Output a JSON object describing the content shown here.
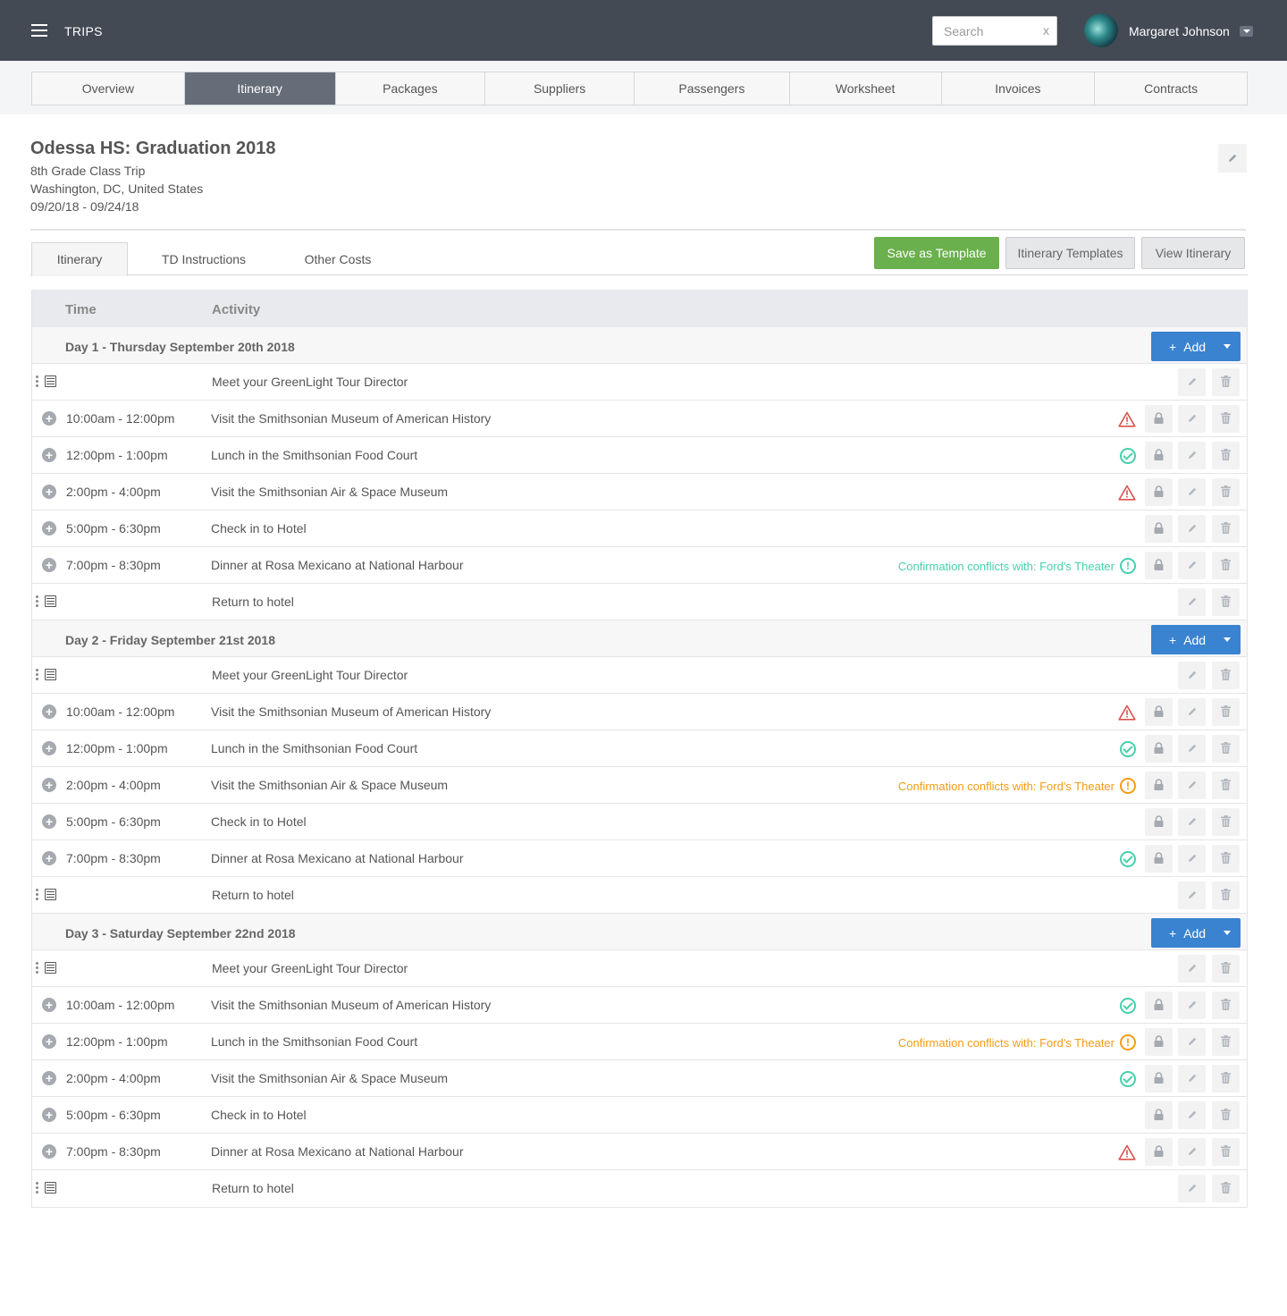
{
  "app": {
    "title": "TRIPS"
  },
  "search": {
    "placeholder": "Search",
    "clear": "x"
  },
  "user": {
    "name": "Margaret Johnson"
  },
  "main_tabs": [
    "Overview",
    "Itinerary",
    "Packages",
    "Suppliers",
    "Passengers",
    "Worksheet",
    "Invoices",
    "Contracts"
  ],
  "main_tab_active": "Itinerary",
  "trip": {
    "title": "Odessa HS: Graduation 2018",
    "subtitle": "8th Grade Class Trip",
    "location": "Washington, DC, United States",
    "dates": "09/20/18 - 09/24/18"
  },
  "sub_tabs": [
    "Itinerary",
    "TD Instructions",
    "Other Costs"
  ],
  "actions": {
    "save_template": "Save as Template",
    "itinerary_templates": "Itinerary Templates",
    "view_itinerary": "View Itinerary"
  },
  "table": {
    "col_time": "Time",
    "col_activity": "Activity",
    "add_label": "Add",
    "add_plus": "+"
  },
  "colors": {
    "topbar": "#434a54",
    "primary": "#3a83d0",
    "success": "#6ab04c",
    "teal": "#48cfad",
    "orange": "#f39c12",
    "danger": "#d9534f"
  },
  "days": [
    {
      "title": "Day 1 - Thursday September 20th 2018",
      "items": [
        {
          "kind": "note",
          "time": "",
          "activity": "Meet your GreenLight Tour Director",
          "status": "none",
          "status_text": "",
          "lock": false
        },
        {
          "kind": "event",
          "time": "10:00am - 12:00pm",
          "activity": "Visit the Smithsonian Museum of American History",
          "status": "warning-icon",
          "status_text": "",
          "lock": true
        },
        {
          "kind": "event",
          "time": "12:00pm - 1:00pm",
          "activity": "Lunch in the Smithsonian Food Court",
          "status": "check-icon",
          "status_text": "",
          "lock": true
        },
        {
          "kind": "event",
          "time": "2:00pm - 4:00pm",
          "activity": "Visit the Smithsonian Air & Space Museum",
          "status": "warning-icon",
          "status_text": "",
          "lock": true
        },
        {
          "kind": "event",
          "time": "5:00pm - 6:30pm",
          "activity": "Check in to Hotel",
          "status": "none",
          "status_text": "",
          "lock": true
        },
        {
          "kind": "event",
          "time": "7:00pm - 8:30pm",
          "activity": "Dinner at Rosa Mexicano at National Harbour",
          "status": "conflict-teal",
          "status_text": "Confirmation conflicts with: Ford's Theater",
          "lock": true
        },
        {
          "kind": "note",
          "time": "",
          "activity": "Return to hotel",
          "status": "none",
          "status_text": "",
          "lock": false
        }
      ]
    },
    {
      "title": "Day 2 - Friday September 21st 2018",
      "items": [
        {
          "kind": "note",
          "time": "",
          "activity": "Meet your GreenLight Tour Director",
          "status": "none",
          "status_text": "",
          "lock": false
        },
        {
          "kind": "event",
          "time": "10:00am - 12:00pm",
          "activity": "Visit the Smithsonian Museum of American History",
          "status": "warning-icon",
          "status_text": "",
          "lock": true
        },
        {
          "kind": "event",
          "time": "12:00pm - 1:00pm",
          "activity": "Lunch in the Smithsonian Food Court",
          "status": "check-icon",
          "status_text": "",
          "lock": true
        },
        {
          "kind": "event",
          "time": "2:00pm - 4:00pm",
          "activity": "Visit the Smithsonian Air & Space Museum",
          "status": "conflict-orange",
          "status_text": "Confirmation conflicts with: Ford's Theater",
          "lock": true
        },
        {
          "kind": "event",
          "time": "5:00pm - 6:30pm",
          "activity": "Check in to Hotel",
          "status": "none",
          "status_text": "",
          "lock": true
        },
        {
          "kind": "event",
          "time": "7:00pm - 8:30pm",
          "activity": "Dinner at Rosa Mexicano at National Harbour",
          "status": "check-icon",
          "status_text": "",
          "lock": true
        },
        {
          "kind": "note",
          "time": "",
          "activity": "Return to hotel",
          "status": "none",
          "status_text": "",
          "lock": false
        }
      ]
    },
    {
      "title": "Day 3 - Saturday September 22nd 2018",
      "items": [
        {
          "kind": "note",
          "time": "",
          "activity": "Meet your GreenLight Tour Director",
          "status": "none",
          "status_text": "",
          "lock": false
        },
        {
          "kind": "event",
          "time": "10:00am - 12:00pm",
          "activity": "Visit the Smithsonian Museum of American History",
          "status": "check-icon",
          "status_text": "",
          "lock": true
        },
        {
          "kind": "event",
          "time": "12:00pm - 1:00pm",
          "activity": "Lunch in the Smithsonian Food Court",
          "status": "conflict-orange",
          "status_text": "Confirmation conflicts with: Ford's Theater",
          "lock": true
        },
        {
          "kind": "event",
          "time": "2:00pm - 4:00pm",
          "activity": "Visit the Smithsonian Air & Space Museum",
          "status": "check-icon",
          "status_text": "",
          "lock": true
        },
        {
          "kind": "event",
          "time": "5:00pm - 6:30pm",
          "activity": "Check in to Hotel",
          "status": "none",
          "status_text": "",
          "lock": true
        },
        {
          "kind": "event",
          "time": "7:00pm - 8:30pm",
          "activity": "Dinner at Rosa Mexicano at National Harbour",
          "status": "warning-icon",
          "status_text": "",
          "lock": true
        },
        {
          "kind": "note",
          "time": "",
          "activity": "Return to hotel",
          "status": "none",
          "status_text": "",
          "lock": false
        }
      ]
    }
  ]
}
